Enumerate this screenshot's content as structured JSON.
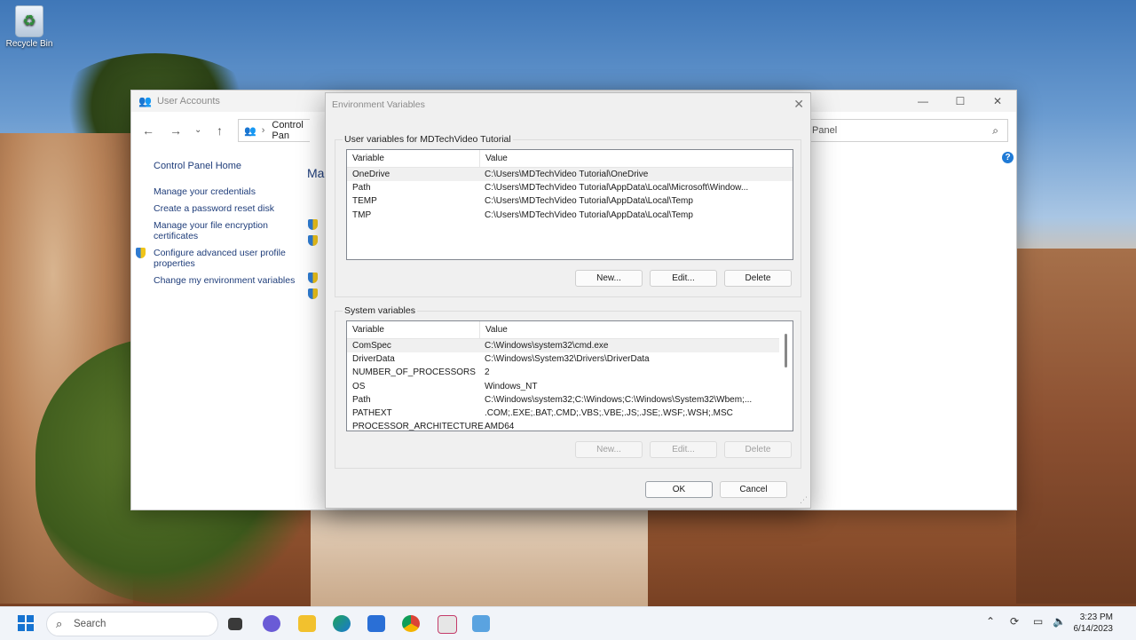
{
  "desktop": {
    "recycle_bin_label": "Recycle Bin"
  },
  "user_accounts": {
    "title": "User Accounts",
    "address_text": "Control Pan",
    "search_text": "Panel",
    "main_title_partial": "Ma",
    "left_nav": {
      "home": "Control Panel Home",
      "links": [
        "Manage your credentials",
        "Create a password reset disk",
        "Manage your file encryption certificates",
        "Configure advanced user profile properties",
        "Change my environment variables"
      ]
    }
  },
  "env_dialog": {
    "title": "Environment Variables",
    "user_group_label": "User variables for MDTechVideo Tutorial",
    "system_group_label": "System variables",
    "columns": {
      "variable": "Variable",
      "value": "Value"
    },
    "user_vars": [
      {
        "variable": "OneDrive",
        "value": "C:\\Users\\MDTechVideo Tutorial\\OneDrive"
      },
      {
        "variable": "Path",
        "value": "C:\\Users\\MDTechVideo Tutorial\\AppData\\Local\\Microsoft\\Window..."
      },
      {
        "variable": "TEMP",
        "value": "C:\\Users\\MDTechVideo Tutorial\\AppData\\Local\\Temp"
      },
      {
        "variable": "TMP",
        "value": "C:\\Users\\MDTechVideo Tutorial\\AppData\\Local\\Temp"
      }
    ],
    "system_vars": [
      {
        "variable": "ComSpec",
        "value": "C:\\Windows\\system32\\cmd.exe"
      },
      {
        "variable": "DriverData",
        "value": "C:\\Windows\\System32\\Drivers\\DriverData"
      },
      {
        "variable": "NUMBER_OF_PROCESSORS",
        "value": "2"
      },
      {
        "variable": "OS",
        "value": "Windows_NT"
      },
      {
        "variable": "Path",
        "value": "C:\\Windows\\system32;C:\\Windows;C:\\Windows\\System32\\Wbem;..."
      },
      {
        "variable": "PATHEXT",
        "value": ".COM;.EXE;.BAT;.CMD;.VBS;.VBE;.JS;.JSE;.WSF;.WSH;.MSC"
      },
      {
        "variable": "PROCESSOR_ARCHITECTURE",
        "value": "AMD64"
      }
    ],
    "buttons": {
      "new": "New...",
      "edit": "Edit...",
      "delete": "Delete",
      "ok": "OK",
      "cancel": "Cancel"
    }
  },
  "taskbar": {
    "search_placeholder": "Search",
    "time": "3:23 PM",
    "date": "6/14/2023"
  },
  "colors": {
    "link_blue": "#1f3d7a",
    "accent_blue": "#1673d1"
  }
}
